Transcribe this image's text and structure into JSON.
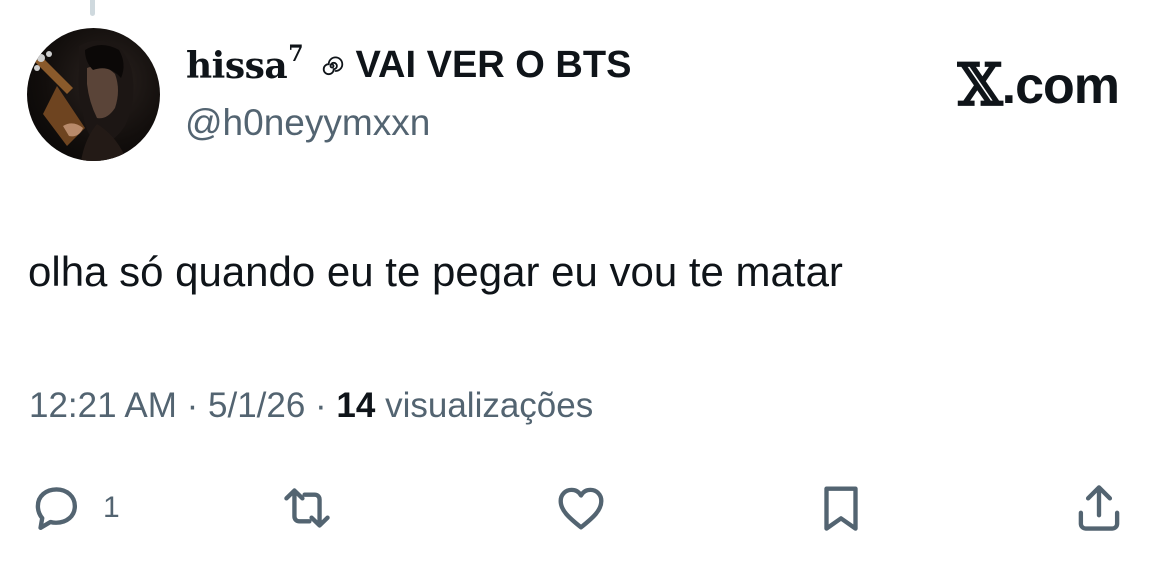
{
  "tweet": {
    "user": {
      "display_name_script": "hissa",
      "display_name_sup": "7",
      "display_name_tail": "VAI VER O BTS",
      "handle": "@h0neyymxxn"
    },
    "brand": {
      "x_glyph": "𝕏",
      "suffix": ".com"
    },
    "text": "olha só quando eu te pegar eu vou te matar",
    "meta": {
      "time": "12:21 AM",
      "sep1": " · ",
      "date": "5/1/26",
      "sep2": " · ",
      "views_count": "14",
      "views_label": " visualizações"
    },
    "actions": {
      "reply_count": "1"
    }
  }
}
